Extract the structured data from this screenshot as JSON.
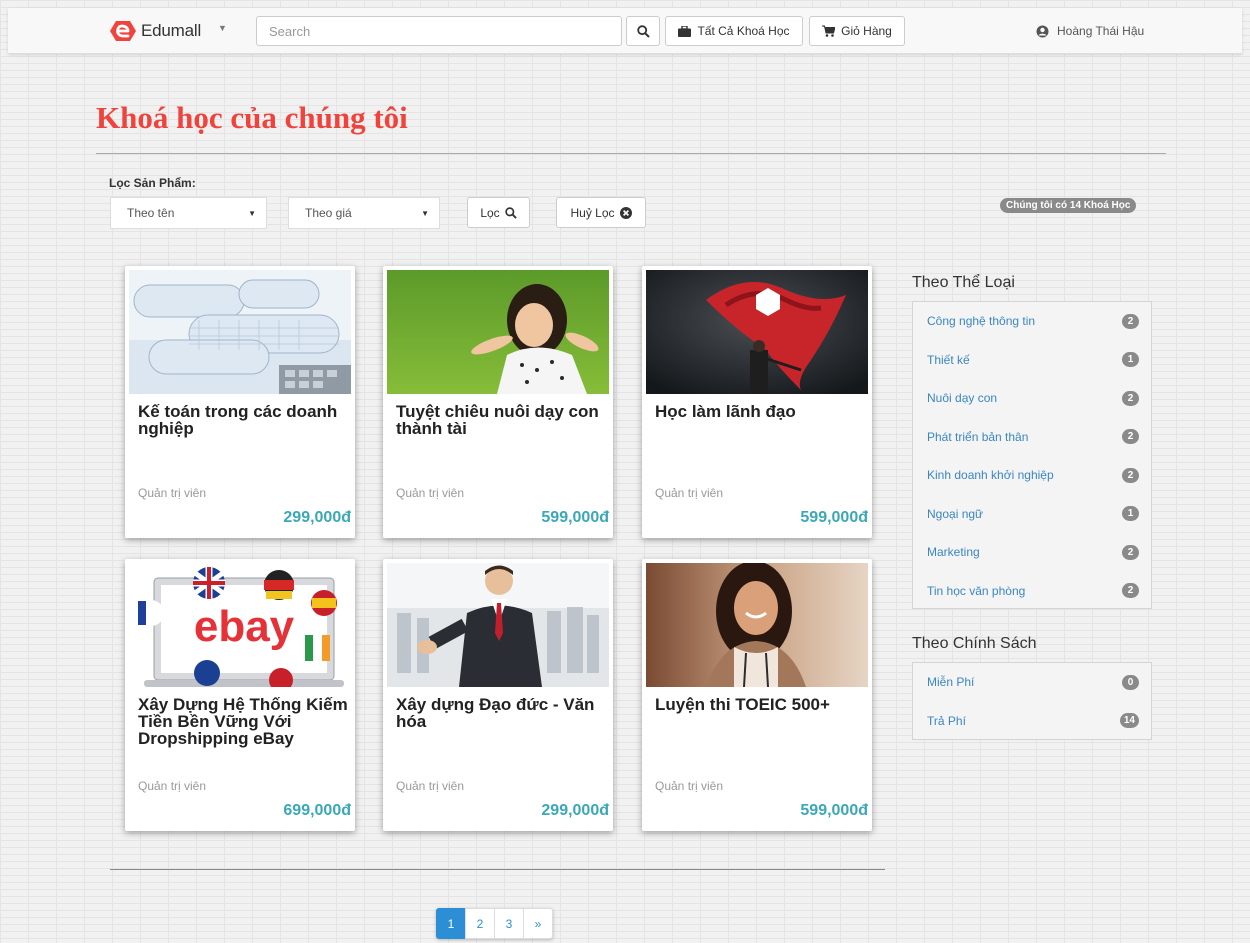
{
  "navbar": {
    "brand": "Edumall",
    "search_placeholder": "Search",
    "all_courses_label": "Tất Cả Khoá Học",
    "cart_label": "Giỏ Hàng",
    "user_name": "Hoàng Thái Hậu"
  },
  "page": {
    "title": "Khoá học của chúng tôi"
  },
  "filter": {
    "label": "Lọc Sản Phẩm:",
    "by_name": "Theo tên",
    "by_price": "Theo giá",
    "filter_button": "Lọc",
    "clear_button": "Huỷ Lọc",
    "count_text": "Chúng tôi có 14 Khoá Học"
  },
  "courses": [
    {
      "title": "Kế toán trong các doanh nghiệp",
      "author": "Quản trị viên",
      "price": "299,000đ"
    },
    {
      "title": "Tuyệt chiêu nuôi dạy con thành tài",
      "author": "Quản trị viên",
      "price": "599,000đ"
    },
    {
      "title": "Học làm lãnh đạo",
      "author": "Quản trị viên",
      "price": "599,000đ"
    },
    {
      "title": "Xây Dựng Hệ Thống Kiếm Tiền Bền Vững Với Dropshipping eBay",
      "author": "Quản trị viên",
      "price": "699,000đ"
    },
    {
      "title": "Xây dựng Đạo đức - Văn hóa",
      "author": "Quản trị viên",
      "price": "299,000đ"
    },
    {
      "title": "Luyện thi TOEIC 500+",
      "author": "Quản trị viên",
      "price": "599,000đ"
    }
  ],
  "thumb_texts": {
    "ebay": "ebay"
  },
  "pagination": {
    "pages": [
      "1",
      "2",
      "3"
    ],
    "next": "»",
    "active": "1"
  },
  "sidebar": {
    "categories_heading": "Theo Thể Loại",
    "categories": [
      {
        "label": "Công nghệ thông tin",
        "count": "2"
      },
      {
        "label": "Thiết kế",
        "count": "1"
      },
      {
        "label": "Nuôi dạy con",
        "count": "2"
      },
      {
        "label": "Phát triển bản thân",
        "count": "2"
      },
      {
        "label": "Kinh doanh khởi nghiệp",
        "count": "2"
      },
      {
        "label": "Ngoại ngữ",
        "count": "1"
      },
      {
        "label": "Marketing",
        "count": "2"
      },
      {
        "label": "Tin học văn phòng",
        "count": "2"
      }
    ],
    "policy_heading": "Theo Chính Sách",
    "policies": [
      {
        "label": "Miễn Phí",
        "count": "0"
      },
      {
        "label": "Trả Phí",
        "count": "14"
      }
    ]
  },
  "colors": {
    "accent_red": "#f0433c",
    "price_teal": "#3aa8b6",
    "link_blue": "#3a86c4",
    "page_blue": "#2c8fd6"
  }
}
